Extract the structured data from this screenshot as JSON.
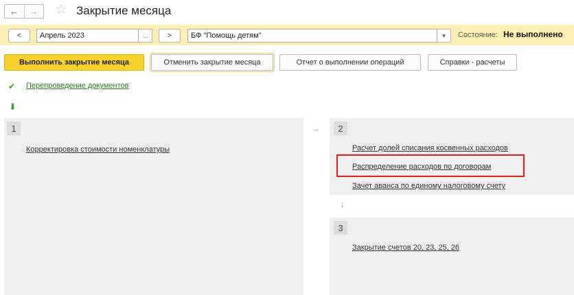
{
  "window": {
    "title": "Закрытие месяца",
    "back_glyph": "←",
    "forward_glyph": "→",
    "favorite_glyph": "☆"
  },
  "filters": {
    "prev_glyph": "<",
    "period_value": "Апрель 2023",
    "period_dots": "...",
    "next_glyph": ">",
    "organization_value": "БФ \"Помощь детям\"",
    "organization_dropdown_glyph": "▾",
    "state_label": "Состояние:",
    "state_value": "Не выполнено"
  },
  "actions": {
    "execute": "Выполнить закрытие месяца",
    "cancel": "Отменить закрытие месяца",
    "report": "Отчет о выполнении операций",
    "calculations": "Справки - расчеты"
  },
  "status": {
    "check_glyph": "✔",
    "repost_link": "Перепроведение документов",
    "down_glyph": "⬇"
  },
  "stages": [
    {
      "number": "1",
      "tasks": [
        "Корректировка стоимости номенклатуры"
      ]
    },
    {
      "number": "2",
      "tasks": [
        "Расчет долей списания косвенных расходов",
        "Распределение расходов по договорам",
        "Зачет аванса по единому налоговому счету"
      ]
    },
    {
      "number": "3",
      "tasks": [
        "Закрытие счетов 20, 23, 25, 26"
      ]
    }
  ],
  "connectors": {
    "right": "→",
    "down": "↓"
  },
  "colors": {
    "filter_bg": "#fbefb4",
    "primary_button": "#f7d22e",
    "done_green": "#3c9c2c",
    "highlight_red": "#e01d1d",
    "block_bg": "#efefef"
  }
}
